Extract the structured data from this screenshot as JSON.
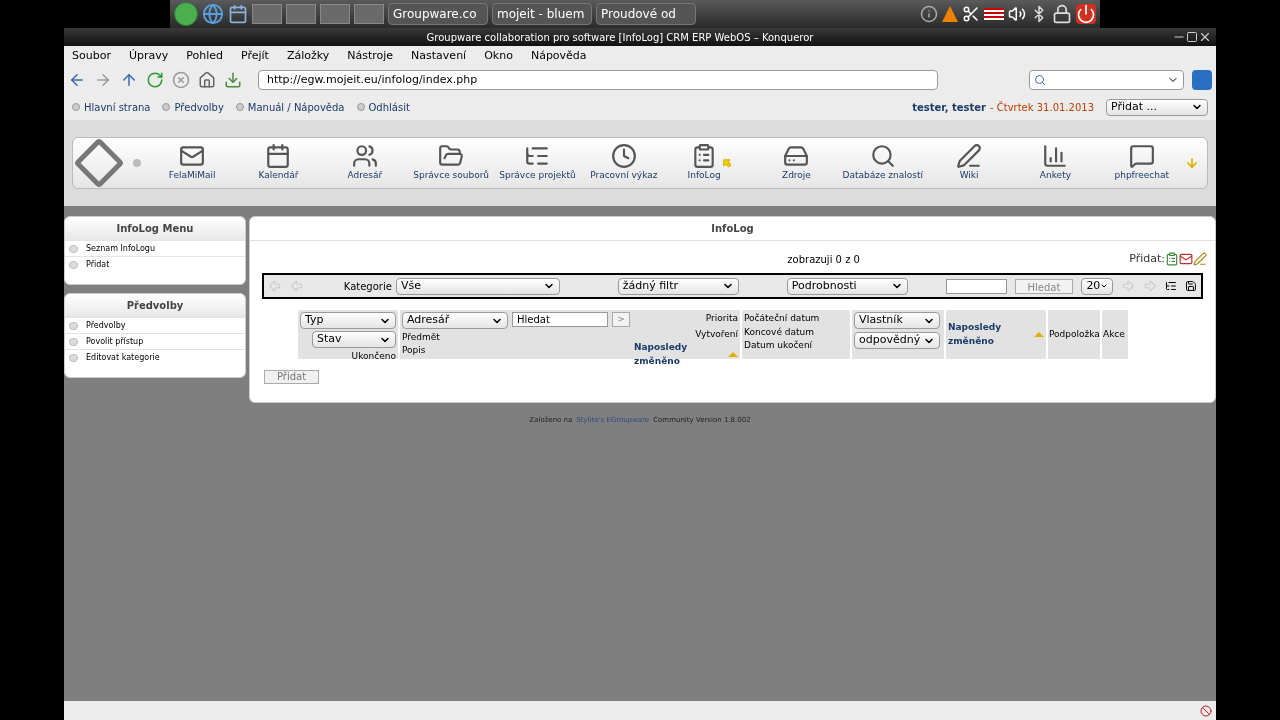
{
  "panel": {
    "tasks": [
      "Groupware.co",
      "mojeit - bluem",
      "Proudové od"
    ]
  },
  "window": {
    "title": "Groupware collaboration pro software [InfoLog] CRM ERP WebOS – Konqueror"
  },
  "menu": [
    "Soubor",
    "Úpravy",
    "Pohled",
    "Přejít",
    "Záložky",
    "Nástroje",
    "Nastavení",
    "Okno",
    "Nápověda"
  ],
  "address": {
    "url": "http://egw.mojeit.eu/infolog/index.php"
  },
  "top_links": [
    "Hlavní strana",
    "Předvolby",
    "Manuál / Nápověda",
    "Odhlásit"
  ],
  "user": {
    "name": "tester, tester",
    "date": "- Čtvrtek 31.01.2013",
    "add_select": "Přidat ..."
  },
  "apps": [
    {
      "label": "FelaMiMail",
      "selected": false
    },
    {
      "label": "Kalendář",
      "selected": false
    },
    {
      "label": "Adresář",
      "selected": false
    },
    {
      "label": "Správce souborů",
      "selected": false
    },
    {
      "label": "Správce projektů",
      "selected": false
    },
    {
      "label": "Pracovní výkaz",
      "selected": false
    },
    {
      "label": "InfoLog",
      "selected": true
    },
    {
      "label": "Zdroje",
      "selected": false
    },
    {
      "label": "Databáze znalostí",
      "selected": false
    },
    {
      "label": "Wiki",
      "selected": false
    },
    {
      "label": "Ankety",
      "selected": false
    },
    {
      "label": "phpfreechat",
      "selected": false
    }
  ],
  "sidebar": [
    {
      "title": "InfoLog Menu",
      "items": [
        "Seznam InfoLogu",
        "Přidat"
      ]
    },
    {
      "title": "Předvolby",
      "items": [
        "Předvolby",
        "Povolit přístup",
        "Editovat kategorie"
      ]
    }
  ],
  "main": {
    "title": "InfoLog",
    "count": "zobrazuji 0 z 0",
    "add_label": "Přidat:",
    "filter": {
      "category_label": "Kategorie",
      "category": "Vše",
      "filter": "žádný filtr",
      "details": "Podrobnosti",
      "search_button": "Hledat",
      "page_size": "20"
    },
    "header": {
      "type": "Typ",
      "status": "Stav",
      "finished": "Ukončeno",
      "contact": "Adresář",
      "search": "Hledat",
      "go": ">",
      "subject": "Předmět",
      "description": "Popis",
      "priority": "Priorita",
      "created": "Vytvoření",
      "modified": "Naposledy změněno",
      "start": "Počáteční datum",
      "end": "Koncové datum",
      "completed": "Datum ukočení",
      "owner": "Vlastník",
      "responsible": "odpovědný",
      "modified2": "Naposledy změněno",
      "subitem": "Podpoložka",
      "actions": "Akce"
    },
    "add_button": "Přidat"
  },
  "footer": {
    "before": "Založeno na",
    "link": "Stylite's EGroupware",
    "after": "Community Version 1.8.002"
  }
}
